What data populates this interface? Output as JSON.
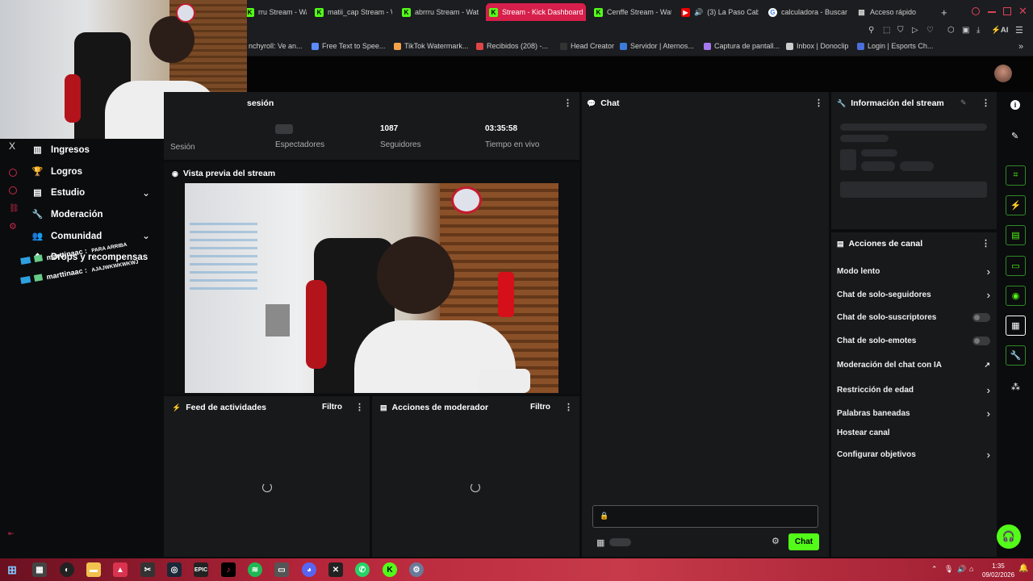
{
  "browser": {
    "tabs": [
      {
        "label": "rru Stream - Wat",
        "fav": "k"
      },
      {
        "label": "matii_cap Stream - W",
        "fav": "k"
      },
      {
        "label": "abrrru Stream - Wat",
        "fav": "k"
      },
      {
        "label": "Stream - Kick Dashboard",
        "fav": "k",
        "active": true
      },
      {
        "label": "Cenffe Stream - Wat",
        "fav": "k"
      },
      {
        "label": "(3) La Paso Cabr",
        "fav": "yt"
      },
      {
        "label": "calculadora - Buscar",
        "fav": "g"
      },
      {
        "label": "Acceso rápido",
        "fav": "grid"
      }
    ],
    "new_tab": "+",
    "ai_label": "AI",
    "bookmarks": [
      "nchyroll: Ve an...",
      "Free Text to Spee...",
      "TikTok Watermark...",
      "Recibidos (208) -...",
      "Head Creator",
      "Servidor | Aternos...",
      "Captura de pantall...",
      "Inbox | Donoclip",
      "Login | Esports Ch..."
    ]
  },
  "session": {
    "title_partial": "sesión",
    "label_session": "Sesión",
    "viewers_label": "Espectadores",
    "followers_value": "1087",
    "followers_label": "Seguidores",
    "live_time_value": "03:35:58",
    "live_time_label": "Tiempo en vivo"
  },
  "preview": {
    "title": "Vista previa del stream"
  },
  "chat": {
    "title": "Chat",
    "send_label": "Chat"
  },
  "stream_info": {
    "title": "Información del stream"
  },
  "channel_actions": {
    "title": "Acciones de canal",
    "items": [
      {
        "label": "Modo lento",
        "control": "chevron"
      },
      {
        "label": "Chat de solo-seguidores",
        "control": "chevron"
      },
      {
        "label": "Chat de solo-suscriptores",
        "control": "toggle"
      },
      {
        "label": "Chat de solo-emotes",
        "control": "toggle"
      },
      {
        "label": "Moderación del chat con IA",
        "control": "external"
      },
      {
        "label": "Restricción de edad",
        "control": "chevron"
      },
      {
        "label": "Palabras baneadas",
        "control": "chevron"
      },
      {
        "label": "Hostear canal",
        "control": "none"
      },
      {
        "label": "Configurar objetivos",
        "control": "chevron"
      }
    ]
  },
  "activity_feed": {
    "title": "Feed de actividades",
    "filter": "Filtro"
  },
  "mod_actions": {
    "title": "Acciones de moderador",
    "filter": "Filtro"
  },
  "sidebar": {
    "items": [
      {
        "label": "Ingresos",
        "icon": "chart-icon"
      },
      {
        "label": "Logros",
        "icon": "trophy-icon"
      },
      {
        "label": "Estudio",
        "icon": "studio-icon",
        "expand": true
      },
      {
        "label": "Moderación",
        "icon": "wrench-icon"
      },
      {
        "label": "Comunidad",
        "icon": "people-icon",
        "expand": true
      },
      {
        "label": "Drops y recompensas",
        "icon": "drops-icon"
      }
    ],
    "x_label": "X"
  },
  "overlay": {
    "chat_user_1": "marttinaac :",
    "chat_msg_1": "PARA ARRIBA",
    "chat_user_2": "marttinaac :",
    "chat_msg_2": "AJAJWKWKWKWJ"
  },
  "taskbar": {
    "time": "1:35",
    "date": "09/02/2026"
  },
  "colors": {
    "accent": "#53fc18",
    "active_tab": "#d71f4b",
    "panel": "#18191b",
    "background": "#0b0c0d"
  }
}
